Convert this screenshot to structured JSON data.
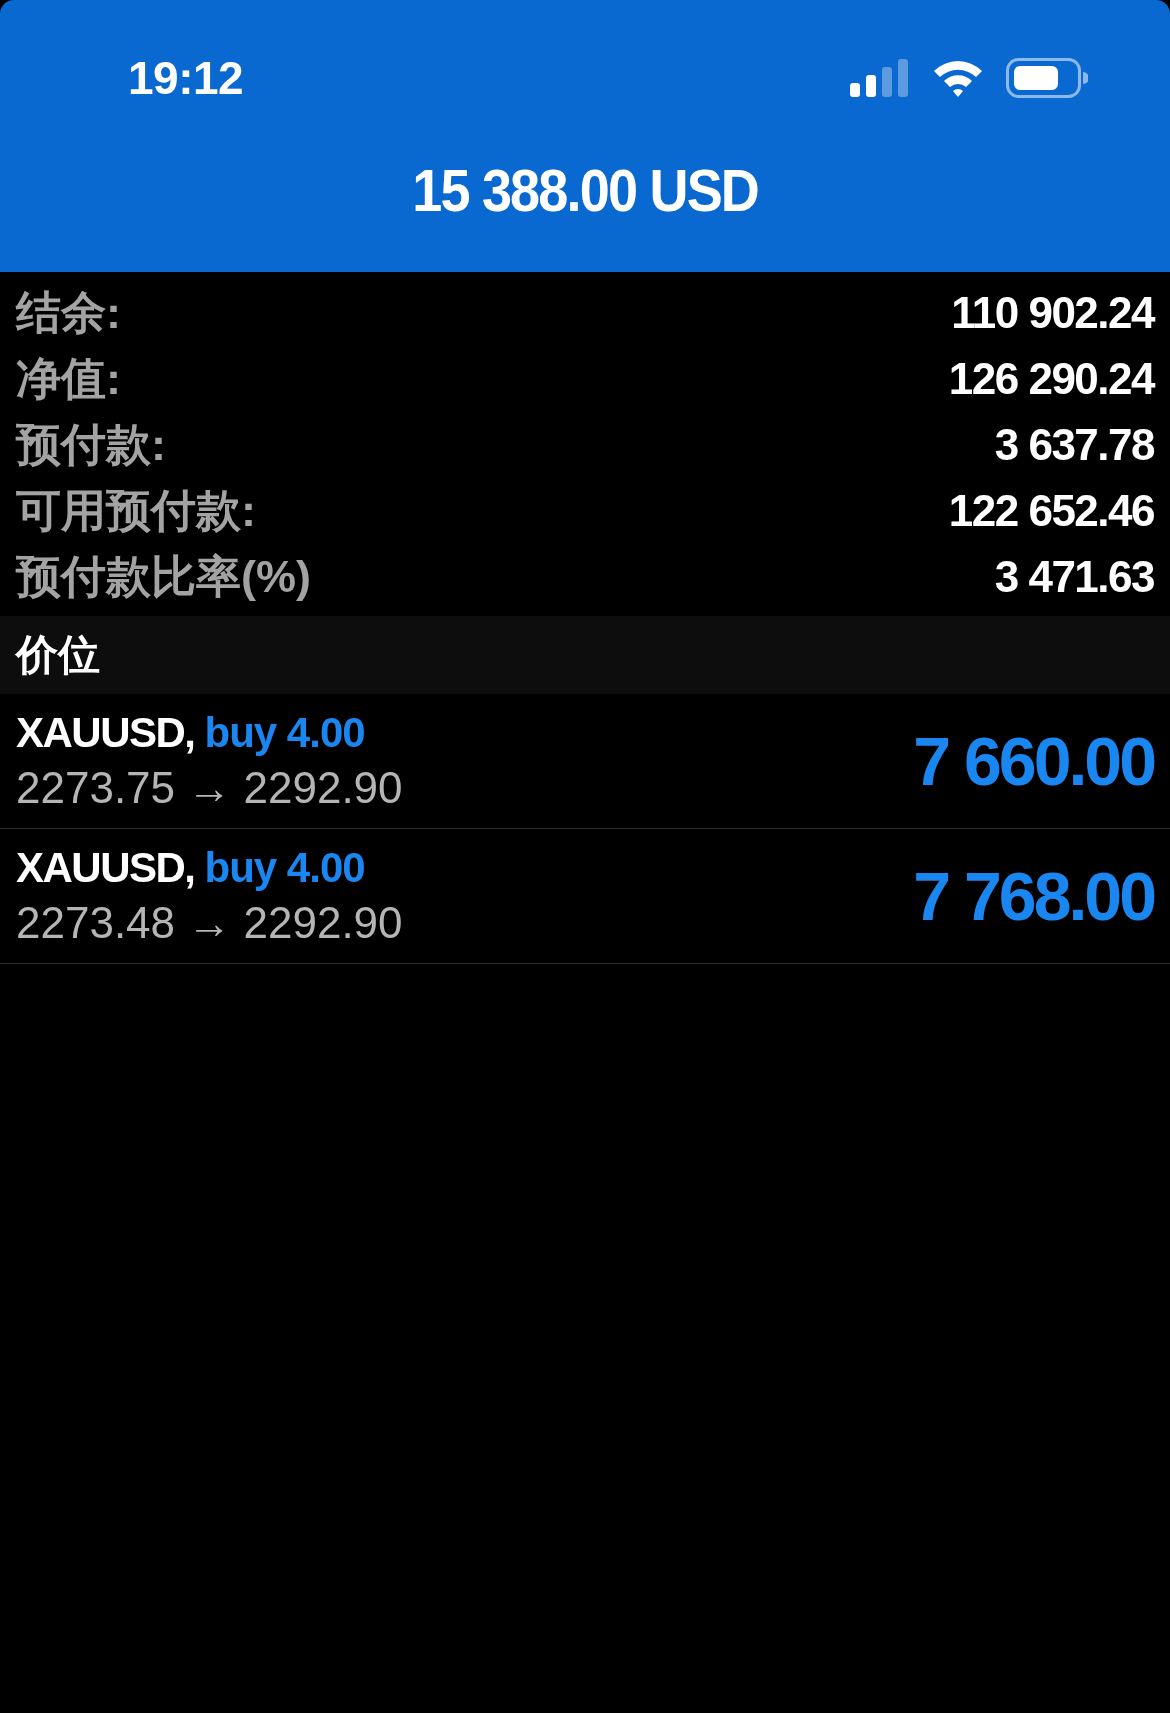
{
  "status_bar": {
    "time": "19:12"
  },
  "header": {
    "title": "15 388.00 USD"
  },
  "summary": [
    {
      "label": "结余:",
      "value": "110 902.24"
    },
    {
      "label": "净值:",
      "value": "126 290.24"
    },
    {
      "label": "预付款:",
      "value": "3 637.78"
    },
    {
      "label": "可用预付款:",
      "value": "122 652.46"
    },
    {
      "label": "预付款比率(%)",
      "value": "3 471.63"
    }
  ],
  "section": {
    "title": "价位"
  },
  "positions": [
    {
      "symbol": "XAUUSD,",
      "trade": "buy 4.00",
      "prices": "2273.75 → 2292.90",
      "profit": "7 660.00"
    },
    {
      "symbol": "XAUUSD,",
      "trade": "buy 4.00",
      "prices": "2273.48 → 2292.90",
      "profit": "7 768.00"
    }
  ]
}
